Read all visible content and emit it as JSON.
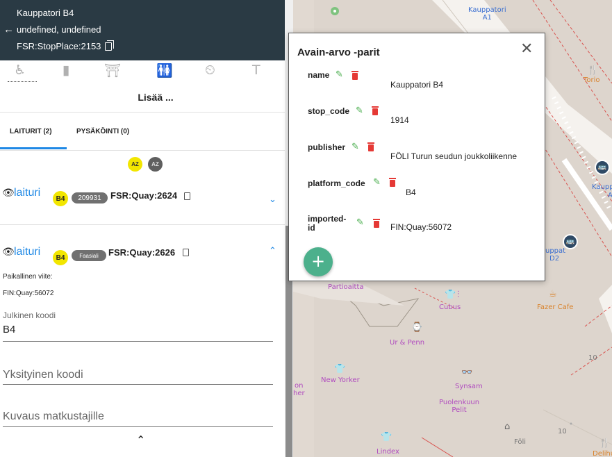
{
  "header": {
    "stop_name": "Kauppatori B4",
    "location": "undefined, undefined",
    "stop_id": "FSR:StopPlace:2153"
  },
  "facility_icons": [
    "wheelchair-icon",
    "ticket-machine-icon",
    "shelter-icon",
    "toilet-icon",
    "waiting-room-icon",
    "sign-icon"
  ],
  "add_more_label": "Lisää ...",
  "tabs": [
    {
      "label": "LAITURIT (2)",
      "active": true
    },
    {
      "label": "PYSÄKÖINTI (0)",
      "active": false
    }
  ],
  "sort_buttons": [
    "AZ",
    "AZ"
  ],
  "quays": [
    {
      "name": "laituri",
      "code": "B4",
      "blob": "209931",
      "id": "FSR:Quay:2624",
      "expanded": false
    },
    {
      "name": "laituri",
      "code": "B4",
      "blob": "Faasiali",
      "id": "FSR:Quay:2626",
      "expanded": true
    }
  ],
  "quay_details": {
    "local_ref_label": "Paikallinen viite:",
    "local_ref_value": "FIN:Quay:56072",
    "public_code_label": "Julkinen koodi",
    "public_code_value": "B4",
    "private_code_placeholder": "Yksityinen koodi",
    "description_placeholder": "Kuvaus matkustajille",
    "collapse_icon": "chevron-up-icon"
  },
  "dialog": {
    "title": "Avain-arvo -parit",
    "pairs": [
      {
        "key": "name",
        "value": "Kauppatori B4"
      },
      {
        "key": "stop_code",
        "value": "1914"
      },
      {
        "key": "publisher",
        "value": "FÖLI Turun seudun joukkoliikenne"
      },
      {
        "key": "platform_code",
        "value": "B4"
      },
      {
        "key": "imported-id",
        "value": "FIN:Quay:56072"
      }
    ],
    "add_icon": "plus-icon"
  },
  "map": {
    "labels": {
      "kauppatori_a1": "Kauppatori\nA1",
      "torio": "Torio",
      "kaupp": "Kaupp",
      "a": "A",
      "upat": "uppat",
      "d2": "D2",
      "partioaitta": "Partioaitta",
      "cubus": "Cubus",
      "fazer": "Fazer Cafe",
      "ur_penn": "Ur & Penn",
      "new_yorker": "New Yorker",
      "on": "on",
      "her": "her",
      "synsam": "Synsam",
      "puolenkuun": "Puolenkuun\nPelit",
      "foli": "Föli",
      "lindex": "Lindex",
      "delihu": "Delihu",
      "ten_a": "10",
      "ten_b": "10"
    }
  },
  "colors": {
    "header_bg": "#2a3a44",
    "accent": "#1e88e5",
    "badge": "#f2e600",
    "fab": "#4cb08c",
    "delete": "#e53935",
    "edit": "#4caf50"
  }
}
